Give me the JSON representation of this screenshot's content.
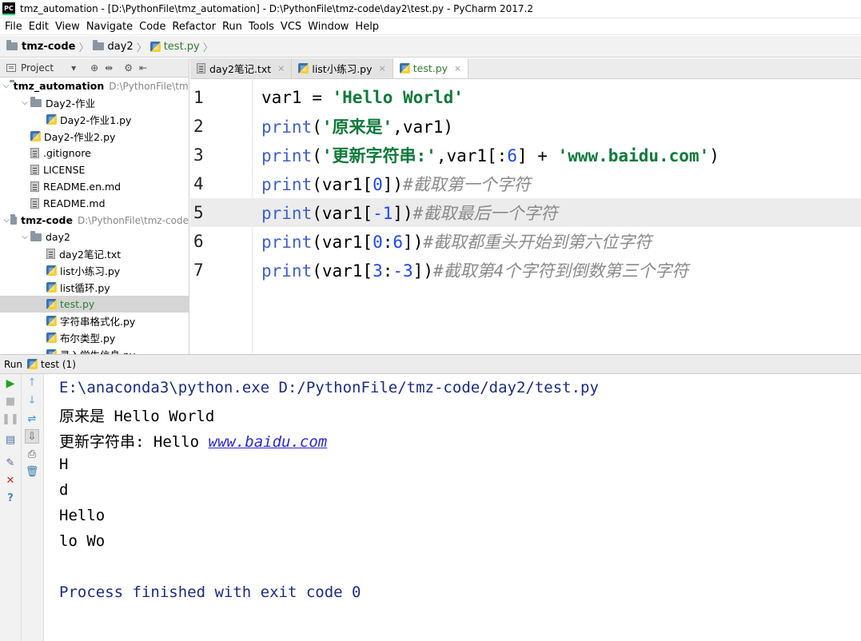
{
  "window": {
    "title": "tmz_automation - [D:\\PythonFile\\tmz_automation] - D:\\PythonFile\\tmz-code\\day2\\test.py - PyCharm 2017.2",
    "app_icon_label": "PC"
  },
  "menu": [
    "File",
    "Edit",
    "View",
    "Navigate",
    "Code",
    "Refactor",
    "Run",
    "Tools",
    "VCS",
    "Window",
    "Help"
  ],
  "breadcrumb": [
    "tmz-code",
    "day2",
    "test.py"
  ],
  "project": {
    "header_label": "Project",
    "tree": [
      {
        "label": "tmz_automation",
        "path": "D:\\PythonFile\\tmz_automation",
        "type": "folder",
        "bold": true,
        "expanded": true
      },
      {
        "label": "Day2-作业",
        "type": "folder",
        "expanded": true
      },
      {
        "label": "Day2-作业1.py",
        "type": "py"
      },
      {
        "label": "Day2-作业2.py",
        "type": "py"
      },
      {
        "label": ".gitignore",
        "type": "txt"
      },
      {
        "label": "LICENSE",
        "type": "txt"
      },
      {
        "label": "README.en.md",
        "type": "txt"
      },
      {
        "label": "README.md",
        "type": "txt"
      },
      {
        "label": "tmz-code",
        "path": "D:\\PythonFile\\tmz-code",
        "type": "folder",
        "bold": true,
        "expanded": true
      },
      {
        "label": "day2",
        "type": "folder",
        "expanded": true
      },
      {
        "label": "day2笔记.txt",
        "type": "txt"
      },
      {
        "label": "list小练习.py",
        "type": "py"
      },
      {
        "label": "list循环.py",
        "type": "py"
      },
      {
        "label": "test.py",
        "type": "py",
        "selected": true
      },
      {
        "label": "字符串格式化.py",
        "type": "py"
      },
      {
        "label": "布尔类型.py",
        "type": "py"
      },
      {
        "label": "录入学生信息.py",
        "type": "py"
      }
    ]
  },
  "editor": {
    "tabs": [
      {
        "label": "day2笔记.txt",
        "type": "txt",
        "active": false
      },
      {
        "label": "list小练习.py",
        "type": "py",
        "active": false
      },
      {
        "label": "test.py",
        "type": "py",
        "active": true
      }
    ],
    "close_glyph": "×",
    "lines": [
      {
        "num": "1",
        "tokens": [
          [
            "plain",
            "var1 = "
          ],
          [
            "str",
            "'Hello World'"
          ]
        ]
      },
      {
        "num": "2",
        "tokens": [
          [
            "kw",
            "print"
          ],
          [
            "plain",
            "("
          ],
          [
            "str",
            "'原来是'"
          ],
          [
            "plain",
            ",var1)"
          ]
        ]
      },
      {
        "num": "3",
        "tokens": [
          [
            "kw",
            "print"
          ],
          [
            "plain",
            "("
          ],
          [
            "str",
            "'更新字符串:'"
          ],
          [
            "plain",
            ",var1[:"
          ],
          [
            "num",
            "6"
          ],
          [
            "plain",
            "] + "
          ],
          [
            "str",
            "'www.baidu.com'"
          ],
          [
            "plain",
            ")"
          ]
        ]
      },
      {
        "num": "4",
        "tokens": [
          [
            "kw",
            "print"
          ],
          [
            "plain",
            "(var1["
          ],
          [
            "num",
            "0"
          ],
          [
            "plain",
            "])"
          ],
          [
            "cm",
            "#截取第一个字符"
          ]
        ]
      },
      {
        "num": "5",
        "tokens": [
          [
            "kw",
            "print"
          ],
          [
            "plain",
            "(var1["
          ],
          [
            "num",
            "-1"
          ],
          [
            "plain",
            "])"
          ],
          [
            "cm",
            "#截取最后一个字符"
          ]
        ],
        "caret": true
      },
      {
        "num": "6",
        "tokens": [
          [
            "kw",
            "print"
          ],
          [
            "plain",
            "(var1["
          ],
          [
            "num",
            "0"
          ],
          [
            "plain",
            ":"
          ],
          [
            "num",
            "6"
          ],
          [
            "plain",
            "])"
          ],
          [
            "cm",
            "#截取都重头开始到第六位字符"
          ]
        ]
      },
      {
        "num": "7",
        "tokens": [
          [
            "kw",
            "print"
          ],
          [
            "plain",
            "(var1["
          ],
          [
            "num",
            "3"
          ],
          [
            "plain",
            ":"
          ],
          [
            "num",
            "-3"
          ],
          [
            "plain",
            "])"
          ],
          [
            "cm",
            "#截取第4个字符到倒数第三个字符"
          ]
        ]
      }
    ]
  },
  "run": {
    "header_label": "Run",
    "tab_label": "test (1)",
    "output": [
      {
        "kind": "cmd",
        "text": "E:\\anaconda3\\python.exe D:/PythonFile/tmz-code/day2/test.py"
      },
      {
        "kind": "plain",
        "text": "原来是 Hello World"
      },
      {
        "kind": "link-line",
        "text": "更新字符串: Hello ",
        "link": "www.baidu.com"
      },
      {
        "kind": "plain",
        "text": "H"
      },
      {
        "kind": "plain",
        "text": "d"
      },
      {
        "kind": "plain",
        "text": "Hello"
      },
      {
        "kind": "plain",
        "text": "lo Wo"
      },
      {
        "kind": "blank",
        "text": ""
      },
      {
        "kind": "exit",
        "text": "Process finished with exit code 0"
      }
    ]
  },
  "colors": {
    "keyword": "#3d5fd2",
    "string": "#0e7a3a",
    "number": "#1a47ff",
    "comment": "#8a8a8a",
    "console_cmd": "#1b2c86",
    "run_green": "#21a321"
  }
}
